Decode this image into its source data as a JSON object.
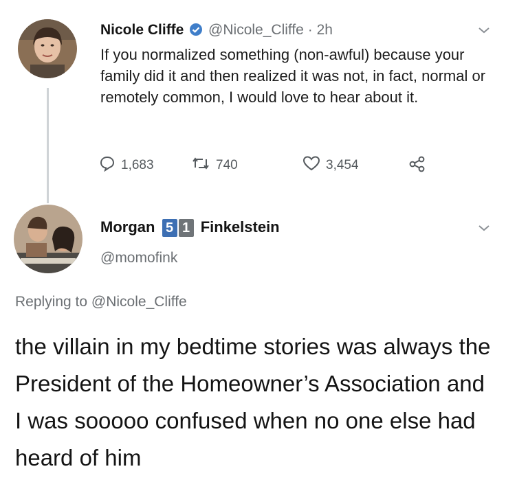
{
  "tweet": {
    "author_name": "Nicole Cliffe",
    "handle": "@Nicole_Cliffe",
    "separator": "·",
    "time": "2h",
    "text": "If you normalized something (non-awful) because your family did it and then realized it was not, in fact, normal or remotely common, I would love to hear about it.",
    "replies": "1,683",
    "retweets": "740",
    "likes": "3,454"
  },
  "reply": {
    "name_first": "Morgan",
    "badge_1": "5",
    "badge_2": "1",
    "name_last": "Finkelstein",
    "handle": "@momofink",
    "replying_to_label": "Replying to",
    "replying_to_handle": "@Nicole_Cliffe",
    "text": "the villain in my bedtime stories was always the President of the Homeowner’s Association and I was sooooo confused when no one else had heard of him"
  },
  "colors": {
    "verified": "#3f7ec9",
    "badge_blue": "#3d6fb3",
    "badge_gray": "#6f7478",
    "link": "#6b6f73"
  },
  "icons": [
    "verified-icon",
    "chevron-down-icon",
    "reply-icon",
    "retweet-icon",
    "like-icon",
    "share-icon"
  ]
}
